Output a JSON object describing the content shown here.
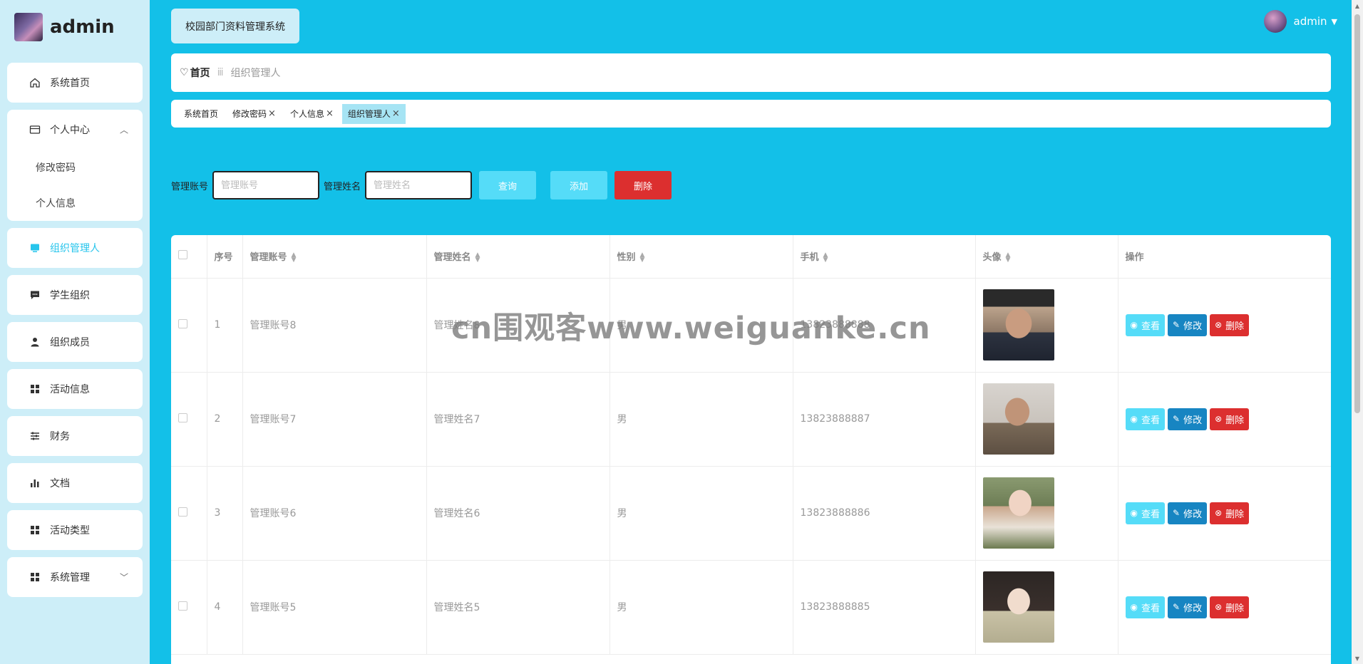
{
  "brand": {
    "name": "admin"
  },
  "sidebar": {
    "items": [
      {
        "label": "系统首页",
        "icon": "home-icon"
      },
      {
        "label": "个人中心",
        "icon": "wallet-icon",
        "expanded": true,
        "children": [
          {
            "label": "修改密码"
          },
          {
            "label": "个人信息"
          }
        ]
      },
      {
        "label": "组织管理人",
        "icon": "monitor-icon",
        "active": true
      },
      {
        "label": "学生组织",
        "icon": "chat-icon"
      },
      {
        "label": "组织成员",
        "icon": "user-icon"
      },
      {
        "label": "活动信息",
        "icon": "grid-icon"
      },
      {
        "label": "财务",
        "icon": "sliders-icon"
      },
      {
        "label": "文档",
        "icon": "bar-chart-icon"
      },
      {
        "label": "活动类型",
        "icon": "grid-icon"
      },
      {
        "label": "系统管理",
        "icon": "grid-icon",
        "expanded": false
      }
    ]
  },
  "header": {
    "system_title": "校园部门资料管理系统",
    "user_name": "admin"
  },
  "breadcrumb": {
    "home": "首页",
    "separator": "ⅲ",
    "current": "组织管理人"
  },
  "tags": [
    {
      "label": "系统首页",
      "closable": false,
      "active": false
    },
    {
      "label": "修改密码",
      "closable": true,
      "active": false
    },
    {
      "label": "个人信息",
      "closable": true,
      "active": false
    },
    {
      "label": "组织管理人",
      "closable": true,
      "active": true
    }
  ],
  "search": {
    "account_label": "管理账号",
    "account_placeholder": "管理账号",
    "name_label": "管理姓名",
    "name_placeholder": "管理姓名",
    "query_btn": "查询",
    "add_btn": "添加",
    "delete_btn": "删除"
  },
  "table": {
    "columns": [
      "序号",
      "管理账号",
      "管理姓名",
      "性别",
      "手机",
      "头像",
      "操作"
    ],
    "rows": [
      {
        "index": "1",
        "account": "管理账号8",
        "name": "管理姓名8",
        "gender": "男",
        "phone": "13823888888"
      },
      {
        "index": "2",
        "account": "管理账号7",
        "name": "管理姓名7",
        "gender": "男",
        "phone": "13823888887"
      },
      {
        "index": "3",
        "account": "管理账号6",
        "name": "管理姓名6",
        "gender": "男",
        "phone": "13823888886"
      },
      {
        "index": "4",
        "account": "管理账号5",
        "name": "管理姓名5",
        "gender": "男",
        "phone": "13823888885"
      }
    ],
    "actions": {
      "view": "查看",
      "edit": "修改",
      "delete": "删除"
    }
  },
  "watermark": "cn围观客www.weiguanke.cn",
  "colors": {
    "main_bg": "#13c0e8",
    "sidebar_bg": "#cdeef8",
    "active_text": "#27c5ec",
    "danger": "#dc2f2f",
    "primary": "#1785c2",
    "light_btn": "#55dcf8"
  }
}
